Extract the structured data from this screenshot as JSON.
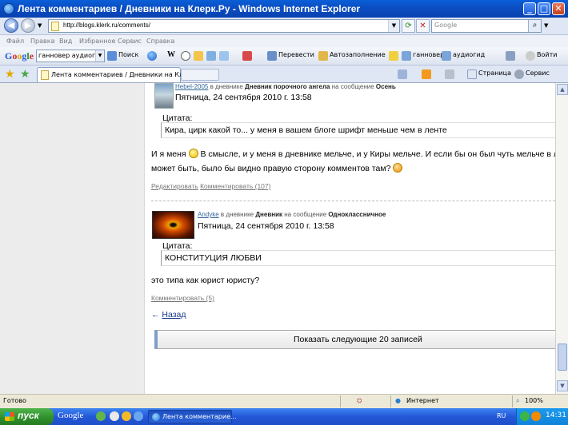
{
  "window": {
    "title": "Лента комментариев / Дневники на Клерк.Ру - Windows Internet Explorer",
    "buttons": {
      "minimize": "_",
      "maximize": "□",
      "close": "✕"
    }
  },
  "address_bar": {
    "url": "http://blogs.klerk.ru/comments/",
    "search_placeholder": "Google"
  },
  "menu": [
    "Файл",
    "Правка",
    "Вид",
    "Избранное",
    "Сервис",
    "Справка"
  ],
  "google_toolbar": {
    "logo": [
      "G",
      "o",
      "o",
      "g",
      "l",
      "e"
    ],
    "query": "ганновер аудиогид",
    "search_label": "Поиск",
    "translate_label": "Перевести",
    "autofill_label": "Автозаполнение",
    "term1": "ганновер",
    "term2": "аудиогид",
    "login_label": "Войти"
  },
  "tabs": {
    "active": "Лента комментариев / Дневники на Клерк.Ру",
    "page_menu": "Страница",
    "tools_menu": "Сервис"
  },
  "comments": [
    {
      "user": "Hebel-2005",
      "in_diary_text": "в дневнике",
      "diary": "Дневник порочного ангела",
      "on_post_text": "на сообщение",
      "post": "Осень",
      "date": "Пятница, 24 сентября 2010 г. 13:58",
      "quote_label": "Цитата:",
      "quote": "Кира, цирк какой то... у меня в вашем блоге шрифт меньше чем в ленте",
      "text_line1_a": "И я меня",
      "text_line1_b": "В смысле, и у меня в дневнике мельче, и у Киры мельче. И если бы он был чуть мельче в лент",
      "text_line2": "может быть, было бы видно правую сторону комментов там?",
      "edit_link": "Редактировать",
      "comment_link": "Комментировать (107)"
    },
    {
      "user": "Andyke",
      "in_diary_text": "в дневнике",
      "diary": "Дневник",
      "on_post_text": "на сообщение",
      "post": "Одноклассничное",
      "date": "Пятница, 24 сентября 2010 г. 13:58",
      "quote_label": "Цитата:",
      "quote": "КОНСТИТУЦИЯ ЛЮБВИ",
      "text": "это типа как юрист юристу?",
      "comment_link": "Комментировать (5)"
    }
  ],
  "back_link": {
    "arrow": "←",
    "label": "Назад"
  },
  "show_more": "Показать следующие 20 записей",
  "statusbar": {
    "left": "Готово",
    "zone": "Интернет",
    "zoom": "100%"
  },
  "taskbar": {
    "start": "пуск",
    "google": "Google",
    "window_button": "Лента комментарие...",
    "lang": "RU",
    "clock": "14:31"
  }
}
